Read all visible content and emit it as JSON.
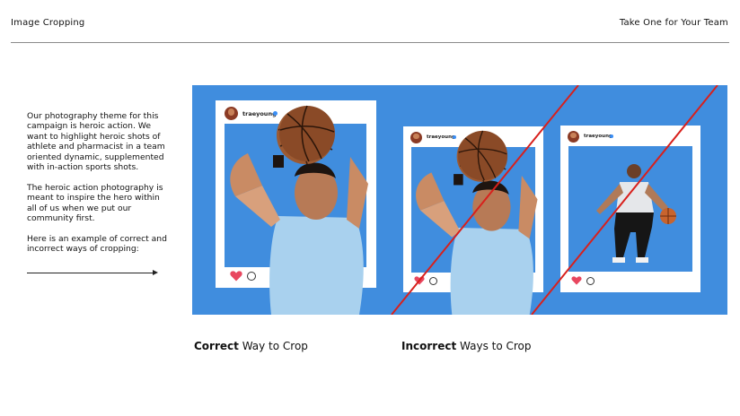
{
  "header": {
    "left": "Image Cropping",
    "right": "Take One for Your Team"
  },
  "body": {
    "paragraph1": "Our photography theme for this campaign is heroic action. We want to highlight heroic shots of athlete and pharmacist in a team oriented dynamic, supplemented with in-action sports shots.",
    "paragraph2": "The heroic action photography is meant to inspire the hero within all of us when we put our community first.",
    "paragraph3": "Here is an example of correct and incorrect ways of cropping:"
  },
  "posts": [
    {
      "handle": "traeyoung"
    },
    {
      "handle": "traeyoung"
    },
    {
      "handle": "traeyoung"
    }
  ],
  "captions": {
    "correct_bold": "Correct",
    "correct_rest": " Way to Crop",
    "incorrect_bold": "Incorrect",
    "incorrect_rest": " Ways to Crop"
  },
  "colors": {
    "stage_blue": "#408dde",
    "strike_red": "#d8201c",
    "heart_red": "#e8475f",
    "verified_blue": "#3a8ef5"
  }
}
